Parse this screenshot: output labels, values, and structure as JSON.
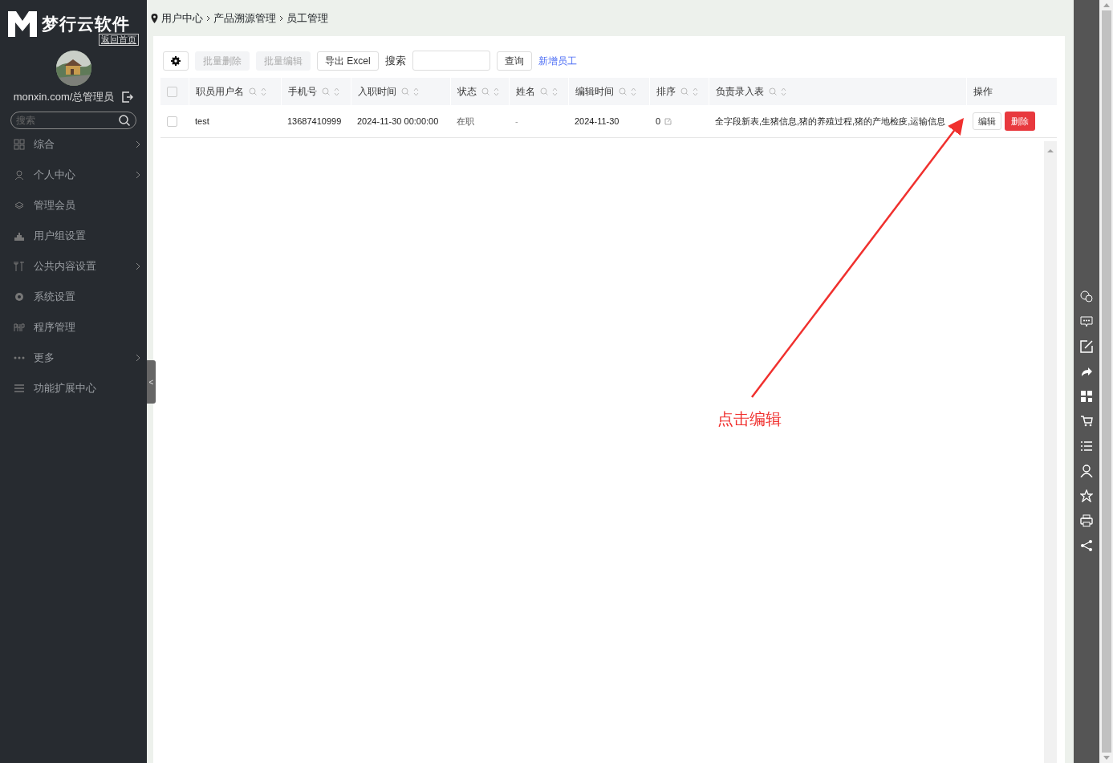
{
  "sidebar": {
    "logo_text": "梦行云软件",
    "back_home": "返回首页",
    "user": "monxin.com/总管理员",
    "search": {
      "placeholder": "搜索"
    },
    "items": [
      {
        "label": "综合",
        "has_children": true
      },
      {
        "label": "个人中心",
        "has_children": true
      },
      {
        "label": "管理会员",
        "has_children": false
      },
      {
        "label": "用户组设置",
        "has_children": false
      },
      {
        "label": "公共内容设置",
        "has_children": true
      },
      {
        "label": "系统设置",
        "has_children": false
      },
      {
        "label": "程序管理",
        "has_children": false
      },
      {
        "label": "更多",
        "has_children": true
      },
      {
        "label": "功能扩展中心",
        "has_children": false
      }
    ],
    "collapse_handle": "<"
  },
  "breadcrumb": [
    "用户中心",
    "产品溯源管理",
    "员工管理"
  ],
  "toolbar": {
    "buttons": [
      {
        "label": "批量删除",
        "disabled": true
      },
      {
        "label": "批量编辑",
        "disabled": true
      },
      {
        "label": "导出 Excel",
        "disabled": false
      }
    ],
    "search_label": "搜索",
    "query_button": "查询",
    "add_link": "新增员工"
  },
  "table": {
    "header_checked": false,
    "columns": [
      {
        "label": "职员用户名",
        "sortable": true
      },
      {
        "label": "手机号",
        "sortable": true
      },
      {
        "label": "入职时间",
        "sortable": true
      },
      {
        "label": "状态",
        "sortable": true
      },
      {
        "label": "姓名",
        "sortable": true
      },
      {
        "label": "编辑时间",
        "sortable": true
      },
      {
        "label": "排序",
        "sortable": true
      },
      {
        "label": "负责录入表",
        "sortable": true
      },
      {
        "label": "操作",
        "sortable": false
      }
    ],
    "rows": [
      {
        "checked": false,
        "cells": [
          "test",
          "13687410999",
          "2024-11-30 00:00:00",
          "在职",
          "-",
          "2024-11-30",
          "0",
          "全字段新表,生猪信息,猪的养殖过程,猪的产地检疫,运输信息"
        ],
        "actions": [
          "编辑",
          "删除"
        ]
      }
    ]
  },
  "annotation": "点击编辑"
}
